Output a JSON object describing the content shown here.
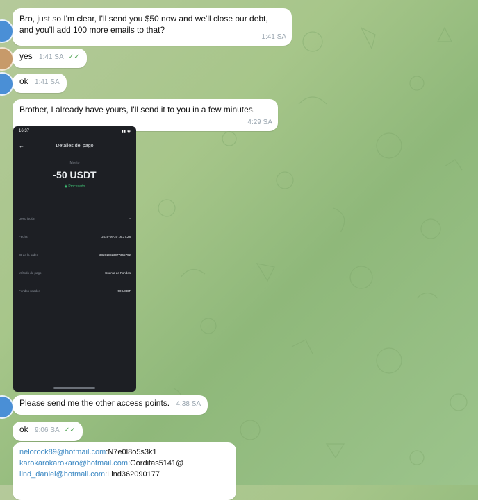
{
  "messages": [
    {
      "text": "Bro, just so I'm clear, I'll send you $50 now and we'll close our debt, and you'll add 100 more emails to that?",
      "time": "1:41 SA"
    },
    {
      "text": "yes",
      "time": "1:41 SA"
    },
    {
      "text": "ok",
      "time": "1:41 SA"
    },
    {
      "text": "Brother, I already have yours, I'll send it to you in a few minutes.",
      "time": "4:29 SA"
    },
    {
      "text": "Please send me the other access points.",
      "time": "4:38 SA"
    },
    {
      "text": "ok",
      "time": "9:06 SA"
    }
  ],
  "check_glyph": "✓✓",
  "phone": {
    "time": "16:37",
    "title": "Detalles del pago",
    "amount_label": "Monto",
    "amount": "-50 USDT",
    "status": "Procesado",
    "rows": [
      {
        "label": "Descripción",
        "value": "--"
      },
      {
        "label": "Fecha",
        "value": "2025-06-20 16:37:28"
      },
      {
        "label": "ID de la orden",
        "value": "382019823077365792"
      },
      {
        "label": "Método de pago",
        "value": "Cuenta de Fondos"
      },
      {
        "label": "Fondos usados",
        "value": "50 USDT"
      }
    ]
  },
  "email_list": [
    {
      "email": "nelorock89@hotmail.com",
      "pass": ":N7e0l8o5s3k1"
    },
    {
      "email": "karokarokarokaro@hotmail.com",
      "pass": ":Gorditas5141@"
    },
    {
      "email": "lind_daniel@hotmail.com",
      "pass": ":Lind362090177"
    }
  ]
}
